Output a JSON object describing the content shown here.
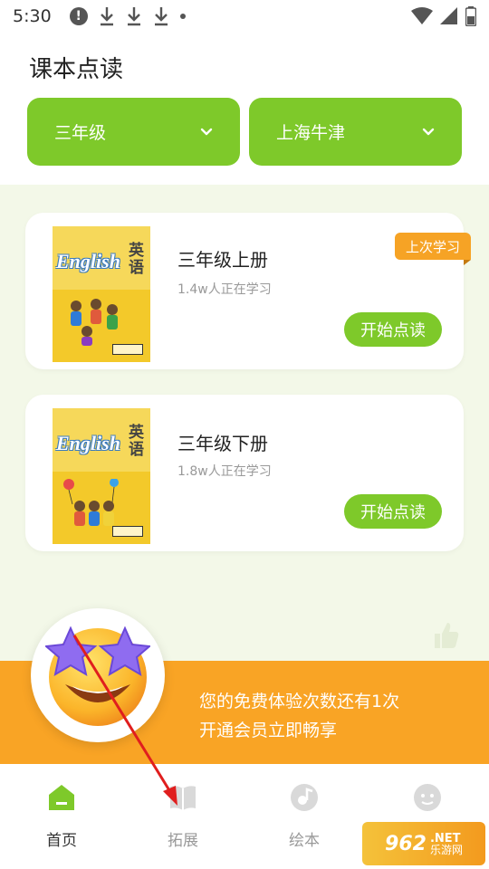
{
  "status_bar": {
    "time": "5:30",
    "alert_icon": "!"
  },
  "header": {
    "title": "课本点读"
  },
  "selectors": [
    {
      "label": "三年级"
    },
    {
      "label": "上海牛津"
    }
  ],
  "books": [
    {
      "title": "三年级上册",
      "learners": "1.4w人正在学习",
      "start_label": "开始点读",
      "badge": "上次学习",
      "cover_en": "English",
      "cover_cn": "英语"
    },
    {
      "title": "三年级下册",
      "learners": "1.8w人正在学习",
      "start_label": "开始点读",
      "cover_en": "English",
      "cover_cn": "英语"
    }
  ],
  "promo": {
    "line1": "您的免费体验次数还有1次",
    "line2": "开通会员立即畅享"
  },
  "tabs": [
    {
      "label": "首页",
      "icon": "home-icon",
      "active": true
    },
    {
      "label": "拓展",
      "icon": "book-icon"
    },
    {
      "label": "绘本",
      "icon": "music-icon"
    },
    {
      "label": "",
      "icon": "profile-icon"
    }
  ],
  "watermark": {
    "num": "962",
    "net": ".NET",
    "cn": "乐游网"
  },
  "colors": {
    "accent_green": "#7ec92a",
    "promo_orange": "#f9a425",
    "badge_orange": "#f6a325",
    "content_bg": "#f3f8e8"
  }
}
